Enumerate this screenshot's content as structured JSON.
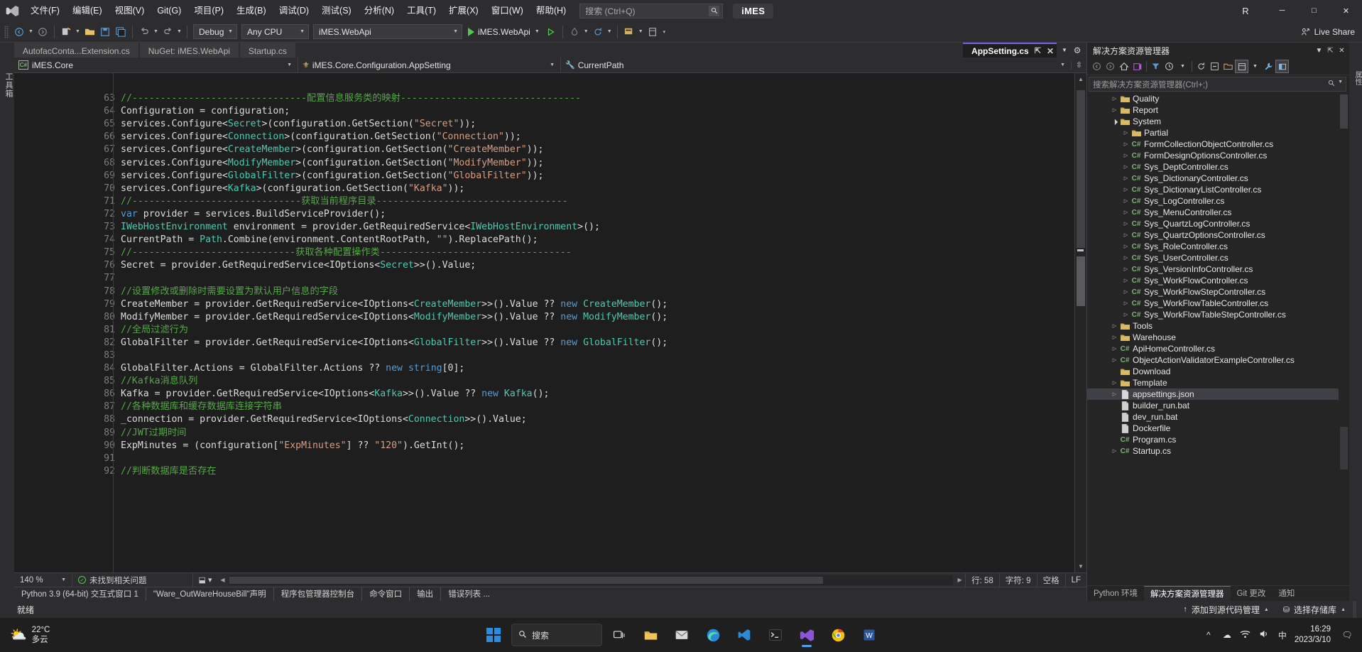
{
  "titlebar": {
    "logo": "visual-studio-logo",
    "menus": [
      "文件(F)",
      "编辑(E)",
      "视图(V)",
      "Git(G)",
      "项目(P)",
      "生成(B)",
      "调试(D)",
      "测试(S)",
      "分析(N)",
      "工具(T)",
      "扩展(X)",
      "窗口(W)",
      "帮助(H)"
    ],
    "search_placeholder": "搜索 (Ctrl+Q)",
    "ide_name": "iMES",
    "account_initial": "R",
    "window_buttons": [
      "─",
      "□",
      "✕"
    ]
  },
  "toolbar": {
    "config": "Debug",
    "platform": "Any CPU",
    "startup_project": "iMES.WebApi",
    "run_label": "iMES.WebApi",
    "live_share": "Live Share"
  },
  "tabs": [
    {
      "label": "AutofacConta...Extension.cs",
      "active": false
    },
    {
      "label": "NuGet: iMES.WebApi",
      "active": false
    },
    {
      "label": "Startup.cs",
      "active": false
    },
    {
      "label": "AppSetting.cs",
      "active": true
    }
  ],
  "navbar": {
    "project": "iMES.Core",
    "type": "iMES.Core.Configuration.AppSetting",
    "member": "CurrentPath"
  },
  "editor": {
    "first_line": 62,
    "lines": [
      {
        "n": 63,
        "tokens": [
          [
            "com",
            "//-------------------------------配置信息服务类的映射--------------------------------"
          ]
        ]
      },
      {
        "n": 64,
        "tokens": [
          [
            "txt",
            "Configuration = configuration;"
          ]
        ]
      },
      {
        "n": 65,
        "tokens": [
          [
            "txt",
            "services.Configure<"
          ],
          [
            "typ",
            "Secret"
          ],
          [
            "txt",
            ">(configuration.GetSection("
          ],
          [
            "str",
            "\"Secret\""
          ],
          [
            "txt",
            "));"
          ]
        ]
      },
      {
        "n": 66,
        "tokens": [
          [
            "txt",
            "services.Configure<"
          ],
          [
            "typ",
            "Connection"
          ],
          [
            "txt",
            ">(configuration.GetSection("
          ],
          [
            "str",
            "\"Connection\""
          ],
          [
            "txt",
            "));"
          ]
        ]
      },
      {
        "n": 67,
        "tokens": [
          [
            "txt",
            "services.Configure<"
          ],
          [
            "typ",
            "CreateMember"
          ],
          [
            "txt",
            ">(configuration.GetSection("
          ],
          [
            "str",
            "\"CreateMember\""
          ],
          [
            "txt",
            "));"
          ]
        ]
      },
      {
        "n": 68,
        "tokens": [
          [
            "txt",
            "services.Configure<"
          ],
          [
            "typ",
            "ModifyMember"
          ],
          [
            "txt",
            ">(configuration.GetSection("
          ],
          [
            "str",
            "\"ModifyMember\""
          ],
          [
            "txt",
            "));"
          ]
        ]
      },
      {
        "n": 69,
        "tokens": [
          [
            "txt",
            "services.Configure<"
          ],
          [
            "typ",
            "GlobalFilter"
          ],
          [
            "txt",
            ">(configuration.GetSection("
          ],
          [
            "str",
            "\"GlobalFilter\""
          ],
          [
            "txt",
            "));"
          ]
        ]
      },
      {
        "n": 70,
        "tokens": [
          [
            "txt",
            "services.Configure<"
          ],
          [
            "typ",
            "Kafka"
          ],
          [
            "txt",
            ">(configuration.GetSection("
          ],
          [
            "str",
            "\"Kafka\""
          ],
          [
            "txt",
            "));"
          ]
        ]
      },
      {
        "n": 71,
        "tokens": [
          [
            "com",
            "//------------------------------获取当前程序目录----------------------------------"
          ]
        ]
      },
      {
        "n": 72,
        "tokens": [
          [
            "kw",
            "var"
          ],
          [
            "txt",
            " provider = services.BuildServiceProvider();"
          ]
        ]
      },
      {
        "n": 73,
        "tokens": [
          [
            "typ",
            "IWebHostEnvironment"
          ],
          [
            "txt",
            " environment = provider.GetRequiredService<"
          ],
          [
            "typ",
            "IWebHostEnvironment"
          ],
          [
            "txt",
            ">();"
          ]
        ]
      },
      {
        "n": 74,
        "tokens": [
          [
            "txt",
            "CurrentPath = "
          ],
          [
            "typ",
            "Path"
          ],
          [
            "txt",
            ".Combine(environment.ContentRootPath, "
          ],
          [
            "str",
            "\"\""
          ],
          [
            "txt",
            ").ReplacePath();"
          ]
        ]
      },
      {
        "n": 75,
        "tokens": [
          [
            "com",
            "//-----------------------------获取各种配置操作类----------------------------------"
          ]
        ]
      },
      {
        "n": 76,
        "tokens": [
          [
            "txt",
            "Secret = provider.GetRequiredService<IOptions<"
          ],
          [
            "typ",
            "Secret"
          ],
          [
            "txt",
            ">>().Value;"
          ]
        ]
      },
      {
        "n": 77,
        "tokens": []
      },
      {
        "n": 78,
        "tokens": [
          [
            "com",
            "//设置修改或删除时需要设置为默认用户信息的字段"
          ]
        ]
      },
      {
        "n": 79,
        "tokens": [
          [
            "txt",
            "CreateMember = provider.GetRequiredService<IOptions<"
          ],
          [
            "typ",
            "CreateMember"
          ],
          [
            "txt",
            ">>().Value ?? "
          ],
          [
            "kw",
            "new"
          ],
          [
            "txt",
            " "
          ],
          [
            "typ",
            "CreateMember"
          ],
          [
            "txt",
            "();"
          ]
        ]
      },
      {
        "n": 80,
        "tokens": [
          [
            "txt",
            "ModifyMember = provider.GetRequiredService<IOptions<"
          ],
          [
            "typ",
            "ModifyMember"
          ],
          [
            "txt",
            ">>().Value ?? "
          ],
          [
            "kw",
            "new"
          ],
          [
            "txt",
            " "
          ],
          [
            "typ",
            "ModifyMember"
          ],
          [
            "txt",
            "();"
          ]
        ]
      },
      {
        "n": 81,
        "tokens": [
          [
            "com",
            "//全局过滤行为"
          ]
        ]
      },
      {
        "n": 82,
        "tokens": [
          [
            "txt",
            "GlobalFilter = provider.GetRequiredService<IOptions<"
          ],
          [
            "typ",
            "GlobalFilter"
          ],
          [
            "txt",
            ">>().Value ?? "
          ],
          [
            "kw",
            "new"
          ],
          [
            "txt",
            " "
          ],
          [
            "typ",
            "GlobalFilter"
          ],
          [
            "txt",
            "();"
          ]
        ]
      },
      {
        "n": 83,
        "tokens": []
      },
      {
        "n": 84,
        "tokens": [
          [
            "txt",
            "GlobalFilter.Actions = GlobalFilter.Actions ?? "
          ],
          [
            "kw",
            "new"
          ],
          [
            "txt",
            " "
          ],
          [
            "kw",
            "string"
          ],
          [
            "txt",
            "[0];"
          ]
        ]
      },
      {
        "n": 85,
        "tokens": [
          [
            "com",
            "//Kafka消息队列"
          ]
        ]
      },
      {
        "n": 86,
        "tokens": [
          [
            "txt",
            "Kafka = provider.GetRequiredService<IOptions<"
          ],
          [
            "typ",
            "Kafka"
          ],
          [
            "txt",
            ">>().Value ?? "
          ],
          [
            "kw",
            "new"
          ],
          [
            "txt",
            " "
          ],
          [
            "typ",
            "Kafka"
          ],
          [
            "txt",
            "();"
          ]
        ]
      },
      {
        "n": 87,
        "tokens": [
          [
            "com",
            "//各种数据库和缓存数据库连接字符串"
          ]
        ]
      },
      {
        "n": 88,
        "tokens": [
          [
            "txt",
            "_connection = provider.GetRequiredService<IOptions<"
          ],
          [
            "typ",
            "Connection"
          ],
          [
            "txt",
            ">>().Value;"
          ]
        ]
      },
      {
        "n": 89,
        "tokens": [
          [
            "com",
            "//JWT过期时间"
          ]
        ]
      },
      {
        "n": 90,
        "tokens": [
          [
            "txt",
            "ExpMinutes = (configuration["
          ],
          [
            "str",
            "\"ExpMinutes\""
          ],
          [
            "txt",
            "] ?? "
          ],
          [
            "str",
            "\"120\""
          ],
          [
            "txt",
            ").GetInt();"
          ]
        ]
      },
      {
        "n": 91,
        "tokens": []
      },
      {
        "n": 92,
        "tokens": [
          [
            "com",
            "//判断数据库是否存在"
          ]
        ]
      }
    ]
  },
  "editor_status": {
    "zoom": "140 %",
    "issues": "未找到相关问题",
    "line_label": "行: 58",
    "col_label": "字符: 9",
    "space_label": "空格",
    "eol_label": "LF"
  },
  "solution": {
    "title": "解决方案资源管理器",
    "search_placeholder": "搜索解决方案资源管理器(Ctrl+;)",
    "tree": [
      {
        "label": "Quality",
        "indent": 2,
        "icon": "folder",
        "chev": "closed",
        "selected": false
      },
      {
        "label": "Report",
        "indent": 2,
        "icon": "folder",
        "chev": "closed",
        "selected": false
      },
      {
        "label": "System",
        "indent": 2,
        "icon": "folder",
        "chev": "open",
        "selected": false
      },
      {
        "label": "Partial",
        "indent": 3,
        "icon": "folder",
        "chev": "closed",
        "selected": false
      },
      {
        "label": "FormCollectionObjectController.cs",
        "indent": 3,
        "icon": "csharp",
        "chev": "closed",
        "selected": false
      },
      {
        "label": "FormDesignOptionsController.cs",
        "indent": 3,
        "icon": "csharp",
        "chev": "closed",
        "selected": false
      },
      {
        "label": "Sys_DeptController.cs",
        "indent": 3,
        "icon": "csharp",
        "chev": "closed",
        "selected": false
      },
      {
        "label": "Sys_DictionaryController.cs",
        "indent": 3,
        "icon": "csharp",
        "chev": "closed",
        "selected": false
      },
      {
        "label": "Sys_DictionaryListController.cs",
        "indent": 3,
        "icon": "csharp",
        "chev": "closed",
        "selected": false
      },
      {
        "label": "Sys_LogController.cs",
        "indent": 3,
        "icon": "csharp",
        "chev": "closed",
        "selected": false
      },
      {
        "label": "Sys_MenuController.cs",
        "indent": 3,
        "icon": "csharp",
        "chev": "closed",
        "selected": false
      },
      {
        "label": "Sys_QuartzLogController.cs",
        "indent": 3,
        "icon": "csharp",
        "chev": "closed",
        "selected": false
      },
      {
        "label": "Sys_QuartzOptionsController.cs",
        "indent": 3,
        "icon": "csharp",
        "chev": "closed",
        "selected": false
      },
      {
        "label": "Sys_RoleController.cs",
        "indent": 3,
        "icon": "csharp",
        "chev": "closed",
        "selected": false
      },
      {
        "label": "Sys_UserController.cs",
        "indent": 3,
        "icon": "csharp",
        "chev": "closed",
        "selected": false
      },
      {
        "label": "Sys_VersionInfoController.cs",
        "indent": 3,
        "icon": "csharp",
        "chev": "closed",
        "selected": false
      },
      {
        "label": "Sys_WorkFlowController.cs",
        "indent": 3,
        "icon": "csharp",
        "chev": "closed",
        "selected": false
      },
      {
        "label": "Sys_WorkFlowStepController.cs",
        "indent": 3,
        "icon": "csharp",
        "chev": "closed",
        "selected": false
      },
      {
        "label": "Sys_WorkFlowTableController.cs",
        "indent": 3,
        "icon": "csharp",
        "chev": "closed",
        "selected": false
      },
      {
        "label": "Sys_WorkFlowTableStepController.cs",
        "indent": 3,
        "icon": "csharp",
        "chev": "closed",
        "selected": false
      },
      {
        "label": "Tools",
        "indent": 2,
        "icon": "folder",
        "chev": "closed",
        "selected": false
      },
      {
        "label": "Warehouse",
        "indent": 2,
        "icon": "folder",
        "chev": "closed",
        "selected": false
      },
      {
        "label": "ApiHomeController.cs",
        "indent": 2,
        "icon": "csharp",
        "chev": "closed",
        "selected": false
      },
      {
        "label": "ObjectActionValidatorExampleController.cs",
        "indent": 2,
        "icon": "csharp",
        "chev": "closed",
        "selected": false
      },
      {
        "label": "Download",
        "indent": 2,
        "icon": "folder",
        "chev": "none",
        "selected": false
      },
      {
        "label": "Template",
        "indent": 2,
        "icon": "folder",
        "chev": "closed",
        "selected": false
      },
      {
        "label": "appsettings.json",
        "indent": 2,
        "icon": "json",
        "chev": "closed",
        "selected": true
      },
      {
        "label": "builder_run.bat",
        "indent": 2,
        "icon": "file",
        "chev": "none",
        "selected": false
      },
      {
        "label": "dev_run.bat",
        "indent": 2,
        "icon": "file",
        "chev": "none",
        "selected": false
      },
      {
        "label": "Dockerfile",
        "indent": 2,
        "icon": "file",
        "chev": "none",
        "selected": false
      },
      {
        "label": "Program.cs",
        "indent": 2,
        "icon": "csharp",
        "chev": "none",
        "selected": false
      },
      {
        "label": "Startup.cs",
        "indent": 2,
        "icon": "csharp",
        "chev": "closed",
        "selected": false
      }
    ],
    "bottom_tabs": [
      {
        "label": "Python 环境",
        "active": false
      },
      {
        "label": "解决方案资源管理器",
        "active": true
      },
      {
        "label": "Git 更改",
        "active": false
      },
      {
        "label": "通知",
        "active": false
      }
    ]
  },
  "bottom_dock": [
    "Python 3.9 (64-bit) 交互式窗口 1",
    "\"Ware_OutWareHouseBill\"声明",
    "程序包管理器控制台",
    "命令窗口",
    "输出",
    "错误列表 ..."
  ],
  "statusbar": {
    "ready": "就绪",
    "source_control": "添加到源代码管理",
    "repo": "选择存储库"
  },
  "left_strip": {
    "label": "工具箱"
  },
  "taskbar": {
    "weather_temp": "22°C",
    "weather_desc": "多云",
    "search_placeholder": "搜索",
    "time": "16:29",
    "date": "2023/3/10",
    "apps": [
      "task-view",
      "file-explorer",
      "mail",
      "edge",
      "vscode",
      "terminal",
      "visual-studio",
      "chrome",
      "word"
    ]
  },
  "colors": {
    "accent_purple": "#7160e8",
    "comment_green": "#57a64a",
    "type_teal": "#4ec9b0",
    "keyword_blue": "#569cd6",
    "string_orange": "#d69d85",
    "chrome_bg": "#2d2d30",
    "editor_bg": "#1e1e1e"
  }
}
